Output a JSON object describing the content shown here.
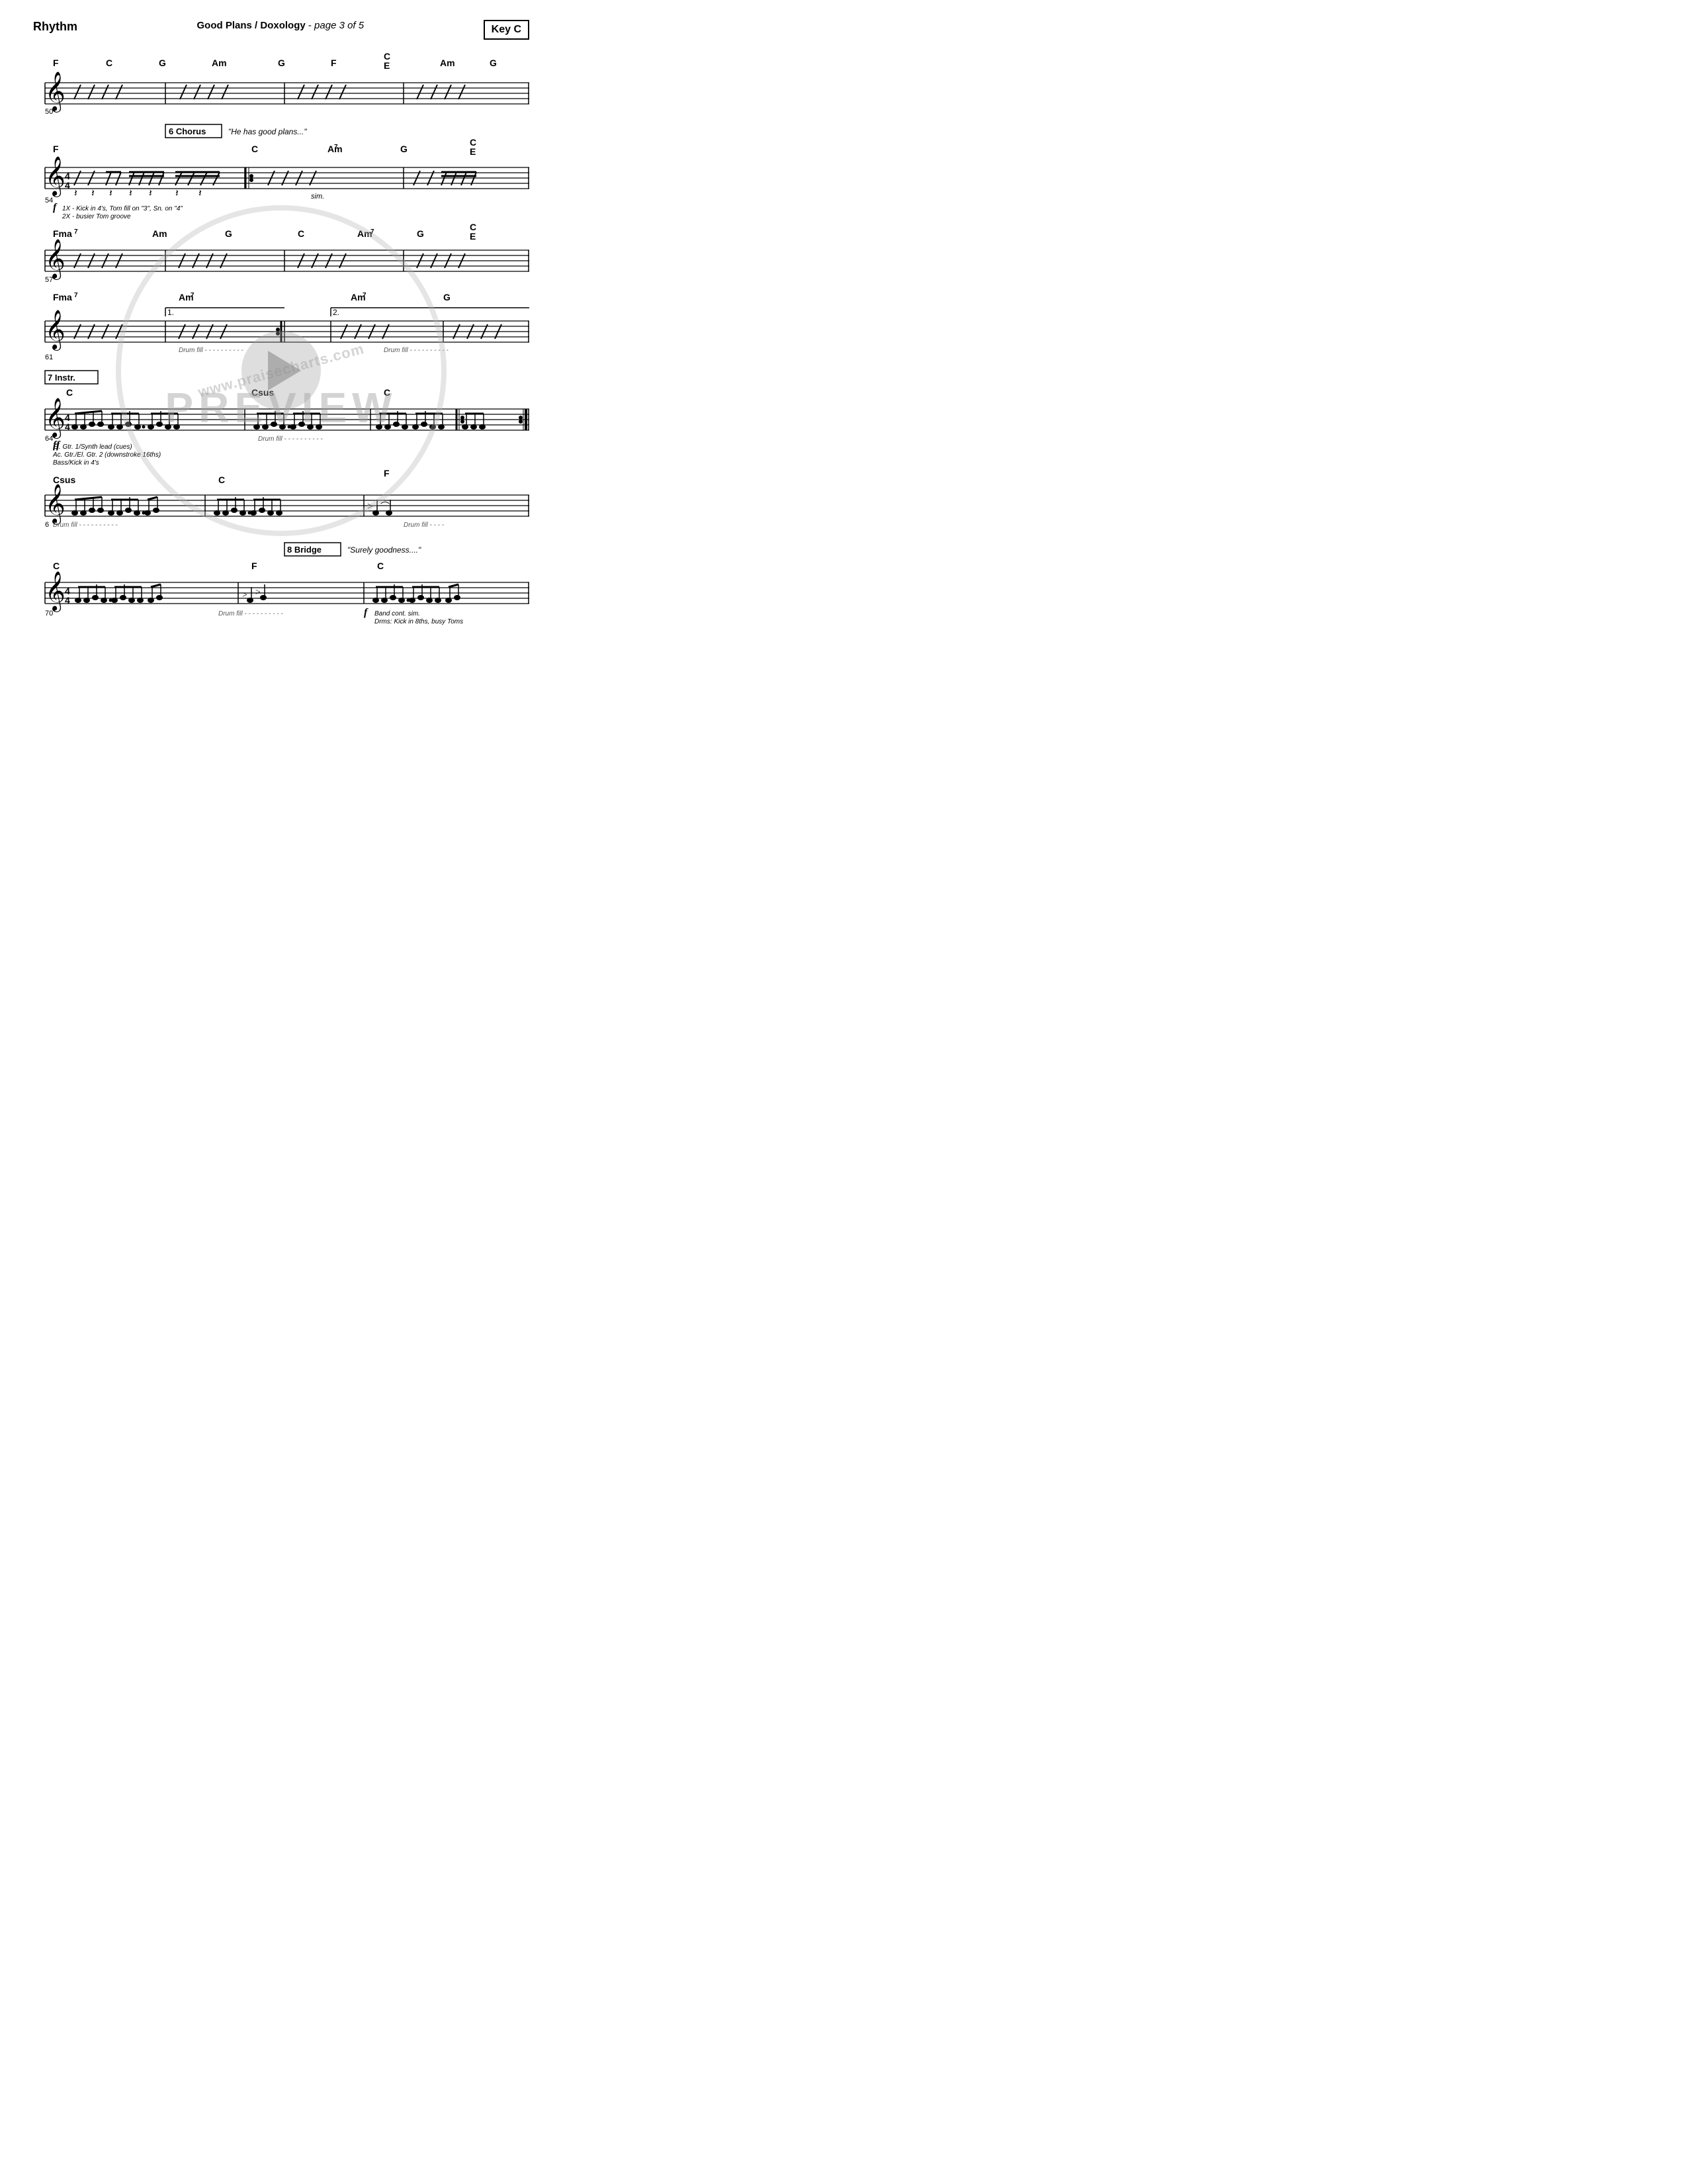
{
  "header": {
    "instrument": "Rhythm",
    "title": "Good Plans / Doxology",
    "page_info": "page 3 of 5",
    "key": "Key C"
  },
  "sections": [
    {
      "id": "section_50",
      "measure_start": 50,
      "chords": [
        "F",
        "C",
        "G",
        "Am",
        "G",
        "F",
        "C/E",
        "Am",
        "G"
      ],
      "type": "rhythm_slashes"
    },
    {
      "id": "section_54",
      "measure_start": 54,
      "section_number": "6",
      "section_name": "Chorus",
      "lyric": "\"He has good plans...\"",
      "chords": [
        "F",
        "",
        "C",
        "Am7",
        "G",
        "C/E"
      ],
      "dynamic": "f",
      "perf_note1": "1X - Kick in 4's, Tom fill on \"3\", Sn. on \"4\"",
      "perf_note2": "2X - busier Tom groove",
      "sim_text": "sim."
    },
    {
      "id": "section_57",
      "measure_start": 57,
      "chords": [
        "Fma7",
        "Am",
        "G",
        "C",
        "Am7",
        "G",
        "C/E"
      ],
      "type": "rhythm_slashes"
    },
    {
      "id": "section_61",
      "measure_start": 61,
      "chords_1": [
        "Fma7",
        "Am7"
      ],
      "chords_2": [
        "Am7",
        "G"
      ],
      "ending1": "1.",
      "ending2": "2.",
      "drum_fill1": "Drum fill - - - - - - - - - -",
      "drum_fill2": "Drum fill - - - - - - - - - -"
    },
    {
      "id": "section_64",
      "measure_start": 64,
      "section_number": "7",
      "section_name": "Instr.",
      "chords": [
        "C",
        "Csus",
        "C"
      ],
      "dynamic": "ff",
      "perf_note1": "El. Gtr. 1/Synth lead (cues)",
      "perf_note2": "Ac. Gtr./El. Gtr. 2 (downstroke 16ths)",
      "perf_note3": "Bass/Kick in 4's",
      "drum_fill": "Drum fill - - - - - - - - - -"
    },
    {
      "id": "section_67",
      "measure_start": 67,
      "chords": [
        "Csus",
        "C",
        "F"
      ],
      "drum_fill1": "Drum fill - - - - - - - - - -",
      "drum_fill2": "Drum fill - - - -"
    },
    {
      "id": "section_70",
      "measure_start": 70,
      "section_number": "8",
      "section_name": "Bridge",
      "lyric": "\"Surely goodness....\"",
      "chords": [
        "C",
        "F",
        "C"
      ],
      "dynamic": "f",
      "perf_note1": "Band cont. sim.",
      "perf_note2": "Drms: Kick in 8ths, busy Toms",
      "drum_fill": "Drum fill - - - - - - - - - -"
    }
  ],
  "watermark": {
    "url": "www.praisecharts.com",
    "preview_text": "PREVIEW"
  }
}
